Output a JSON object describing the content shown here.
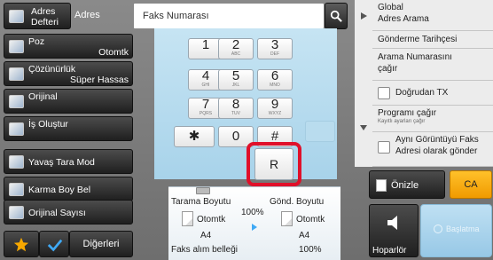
{
  "left_menu": {
    "address_book": {
      "line1": "Adres",
      "line2": "Defteri"
    },
    "items": [
      {
        "name": "Poz",
        "value": "Otomtk"
      },
      {
        "name": "Çözünürlük",
        "value": "Süper Hassas"
      },
      {
        "name": "Orijinal",
        "value": ""
      },
      {
        "name": "İş Oluştur",
        "value": ""
      },
      {
        "name": "Yavaş Tara Mod",
        "value": ""
      },
      {
        "name": "Karma Boy Bel",
        "value": ""
      },
      {
        "name": "Orijinal Sayısı",
        "value": ""
      }
    ],
    "others_label": "Diğerleri"
  },
  "header": {
    "address_label": "Adres",
    "fax_placeholder": "Faks Numarası"
  },
  "keypad": {
    "keys": [
      {
        "main": "1",
        "sub": ""
      },
      {
        "main": "2",
        "sub": "ABC"
      },
      {
        "main": "3",
        "sub": "DEF"
      },
      {
        "main": "4",
        "sub": "GHI"
      },
      {
        "main": "5",
        "sub": "JKL"
      },
      {
        "main": "6",
        "sub": "MNO"
      },
      {
        "main": "7",
        "sub": "PQRS"
      },
      {
        "main": "8",
        "sub": "TUV"
      },
      {
        "main": "9",
        "sub": "WXYZ"
      },
      {
        "main": "✱",
        "sub": ""
      },
      {
        "main": "0",
        "sub": ""
      },
      {
        "main": "#",
        "sub": ""
      }
    ],
    "r_key": "R"
  },
  "right_panel": {
    "global_search": {
      "line1": "Global",
      "line2": "Adres Arama"
    },
    "send_history": "Gönderme Tarihçesi",
    "call_search_number": {
      "line1": "Arama Numarasını",
      "line2": "çağır"
    },
    "direct_tx": "Doğrudan TX",
    "program_call": {
      "line1": "Programı çağır",
      "line2": "Kayıtlı ayarları çağır"
    },
    "same_image": {
      "line1": "Aynı Görüntüyü Faks",
      "line2": "Adresi olarak gönder"
    },
    "preview": "Önizle",
    "ca": "CA",
    "speaker": "Hoparlör",
    "start": "Başlatma"
  },
  "bottom": {
    "scan_size_label": "Tarama Boyutu",
    "send_size_label": "Gönd. Boyutu",
    "ratio": "100%",
    "scan_mode": "Otomtk",
    "scan_paper": "A4",
    "send_mode": "Otomtk",
    "send_paper": "A4",
    "memory_label": "Faks alım belleği",
    "memory_value": "100%"
  },
  "colors": {
    "accent_orange": "#f7a800",
    "highlight_red": "#e0102a",
    "keypad_bg": "#bfe0f1",
    "start_blue": "#a8d2ec"
  }
}
